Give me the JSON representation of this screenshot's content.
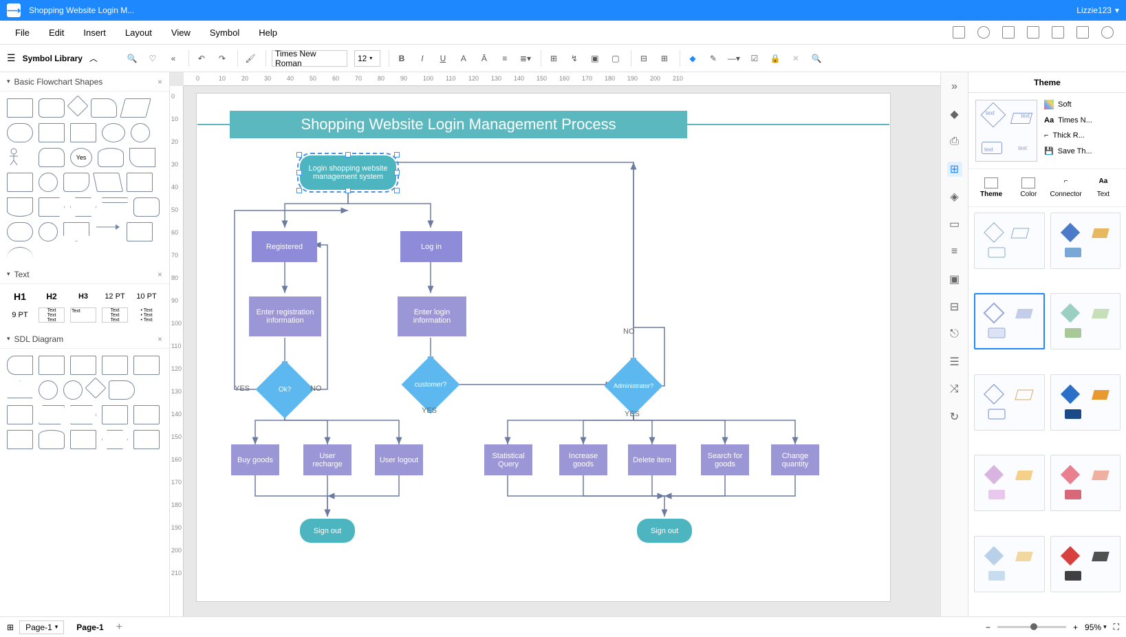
{
  "app": {
    "title": "Shopping Website Login M...",
    "user": "Lizzie123"
  },
  "menu": {
    "file": "File",
    "edit": "Edit",
    "insert": "Insert",
    "layout": "Layout",
    "view": "View",
    "symbol": "Symbol",
    "help": "Help"
  },
  "toolbar": {
    "symbol_library": "Symbol Library",
    "font": "Times New Roman",
    "font_size": "12"
  },
  "left_panel": {
    "section1": "Basic Flowchart Shapes",
    "section2": "Text",
    "section3": "SDL Diagram",
    "text_items": {
      "h1": "H1",
      "h2": "H2",
      "h3": "H3",
      "pt12": "12 PT",
      "pt10": "10 PT",
      "pt9": "9 PT"
    }
  },
  "diagram": {
    "title": "Shopping Website Login Management Process",
    "nodes": {
      "start": "Login shopping website management system",
      "registered": "Registered",
      "login": "Log in",
      "enter_reg": "Enter registration information",
      "enter_login": "Enter login information",
      "ok": "Ok?",
      "customer": "customer?",
      "admin": "Administrator?",
      "buy": "Buy goods",
      "recharge": "User recharge",
      "logout": "User logout",
      "stat": "Statistical Query",
      "increase": "Increase goods",
      "delete": "Delete item",
      "search": "Search for goods",
      "change": "Change quantity",
      "signout1": "Sign out",
      "signout2": "Sign out"
    },
    "labels": {
      "yes": "YES",
      "no": "NO"
    }
  },
  "theme": {
    "header": "Theme",
    "soft": "Soft",
    "font": "Times N...",
    "connector": "Thick R...",
    "save": "Save Th...",
    "tabs": {
      "theme": "Theme",
      "color": "Color",
      "connector": "Connector",
      "text": "Text"
    },
    "preview_text": "text"
  },
  "status": {
    "page_dropdown": "Page-1",
    "page_tab": "Page-1",
    "zoom": "95%"
  }
}
